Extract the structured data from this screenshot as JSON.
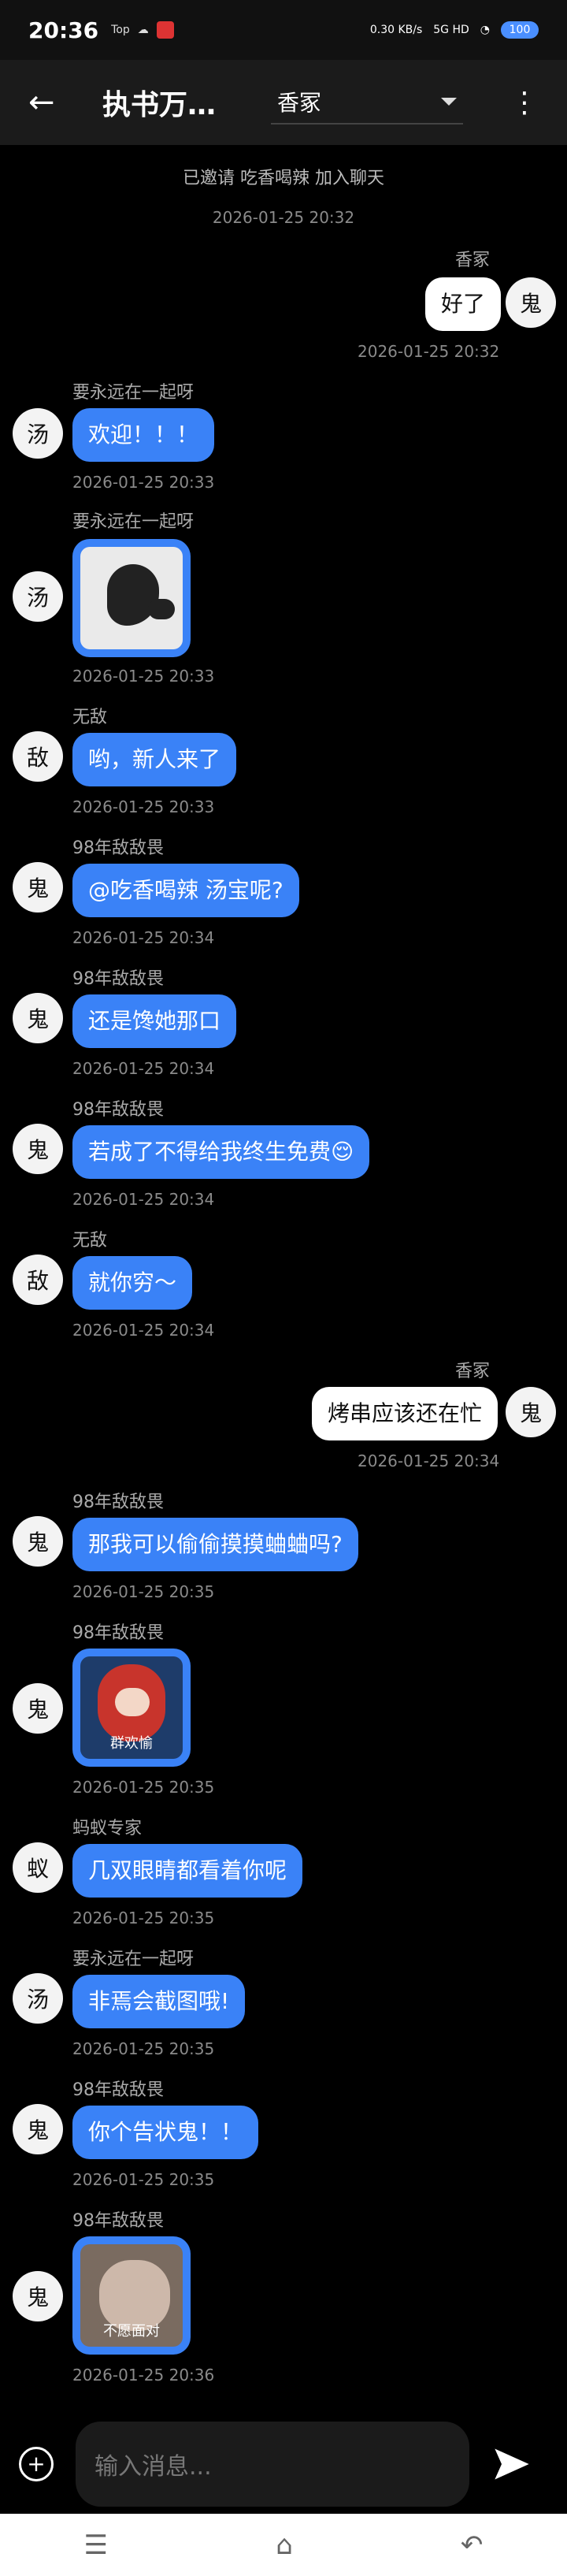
{
  "status": {
    "time": "20:36",
    "network": "0.30 KB/s",
    "signal": "5G HD",
    "battery": "100"
  },
  "header": {
    "title": "执书万…",
    "persona": "香冢"
  },
  "system": {
    "invite": "已邀请 吃香喝辣 加入聊天",
    "invite_time": "2026-01-25 20:32"
  },
  "messages": [
    {
      "side": "out",
      "name": "香冢",
      "type": "text",
      "text": "好了",
      "time": "2026-01-25 20:32",
      "avatar": "鬼"
    },
    {
      "side": "in",
      "name": "要永远在一起呀",
      "type": "text",
      "text": "欢迎！！！",
      "time": "2026-01-25 20:33",
      "avatar": "汤"
    },
    {
      "side": "in",
      "name": "要永远在一起呀",
      "type": "image",
      "caption": "",
      "time": "2026-01-25 20:33",
      "avatar": "汤"
    },
    {
      "side": "in",
      "name": "无敌",
      "type": "text",
      "text": "哟，新人来了",
      "time": "2026-01-25 20:33",
      "avatar": "敌"
    },
    {
      "side": "in",
      "name": "98年敌敌畏",
      "type": "text",
      "text": "@吃香喝辣 汤宝呢?",
      "time": "2026-01-25 20:34",
      "avatar": "鬼"
    },
    {
      "side": "in",
      "name": "98年敌敌畏",
      "type": "text",
      "text": "还是馋她那口",
      "time": "2026-01-25 20:34",
      "avatar": "鬼"
    },
    {
      "side": "in",
      "name": "98年敌敌畏",
      "type": "text",
      "text": "若成了不得给我终生免费😌",
      "time": "2026-01-25 20:34",
      "avatar": "鬼"
    },
    {
      "side": "in",
      "name": "无敌",
      "type": "text",
      "text": "就你穷～",
      "time": "2026-01-25 20:34",
      "avatar": "敌"
    },
    {
      "side": "out",
      "name": "香冢",
      "type": "text",
      "text": "烤串应该还在忙",
      "time": "2026-01-25 20:34",
      "avatar": "鬼"
    },
    {
      "side": "in",
      "name": "98年敌敌畏",
      "type": "text",
      "text": "那我可以偷偷摸摸蛐蛐吗?",
      "time": "2026-01-25 20:35",
      "avatar": "鬼"
    },
    {
      "side": "in",
      "name": "98年敌敌畏",
      "type": "image",
      "caption": "群欢愉",
      "time": "2026-01-25 20:35",
      "avatar": "鬼"
    },
    {
      "side": "in",
      "name": "蚂蚁专家",
      "type": "text",
      "text": "几双眼睛都看着你呢",
      "time": "2026-01-25 20:35",
      "avatar": "蚁"
    },
    {
      "side": "in",
      "name": "要永远在一起呀",
      "type": "text",
      "text": "非焉会截图哦!",
      "time": "2026-01-25 20:35",
      "avatar": "汤"
    },
    {
      "side": "in",
      "name": "98年敌敌畏",
      "type": "text",
      "text": "你个告状鬼！！",
      "time": "2026-01-25 20:35",
      "avatar": "鬼"
    },
    {
      "side": "in",
      "name": "98年敌敌畏",
      "type": "image",
      "caption": "不愿面对",
      "time": "2026-01-25 20:36",
      "avatar": "鬼"
    }
  ],
  "input": {
    "placeholder": "输入消息..."
  },
  "icons": {
    "back": "arrow-left",
    "menu": "more-vert",
    "plus": "plus-circle",
    "send": "send",
    "nav_menu": "menu",
    "nav_home": "home",
    "nav_back": "back"
  }
}
